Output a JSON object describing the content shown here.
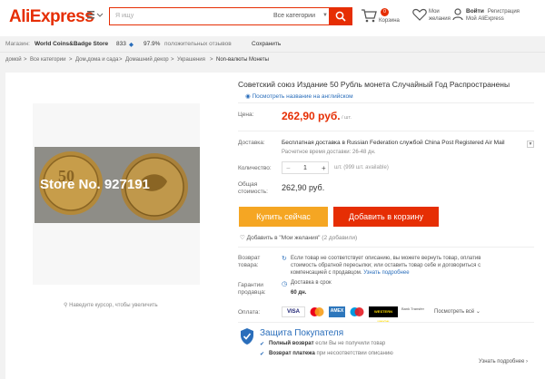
{
  "header": {
    "logo": "AliExpress",
    "search_placeholder": "Я ищу",
    "category": "Все категории",
    "cart_count": "0",
    "cart_label": "Корзина",
    "wishlist_label": "Мои желания",
    "signin": "Войти",
    "register": "Регистрация",
    "my_account": "Мой AliExpress"
  },
  "store": {
    "label": "Магазин:",
    "name": "World Coins&Badge Store",
    "score": "833",
    "positive": "97.9%",
    "positive_label": "положительных отзывов",
    "save": "Сохранить"
  },
  "breadcrumbs": [
    "домой",
    "Все категории",
    "Дом,дома и сада",
    "Домашний декор",
    "Украшения",
    "Non-валюты Монеты"
  ],
  "product": {
    "title": "Советский союз Издание 50 Рубль монета Случайный Год Распространены",
    "translate_link": "Посмотреть название на английском",
    "image_watermark": "Store No. 927191",
    "hint": "Наведите курсор, чтобы увеличить",
    "price_label": "Цена:",
    "price": "262,90 руб.",
    "price_unit": "/ шт.",
    "shipping_label": "Доставка:",
    "shipping_text": "Бесплатная доставка в Russian Federation службой China Post Registered Air Mail",
    "shipping_time": "Расчетное время доставки: 26-48 дн.",
    "qty_label": "Количество:",
    "qty": "1",
    "qty_minus": "−",
    "qty_plus": "+",
    "availability": "шт. (999 шт. available)",
    "total_label_1": "Общая",
    "total_label_2": "стоимость:",
    "total": "262,90 руб.",
    "buy_now": "Купить сейчас",
    "add_to_cart": "Добавить в корзину",
    "wishlist_add": "Добавить в \"Мои желания\"",
    "wishlist_count": "(2 добавили)",
    "return_label_1": "Возврат",
    "return_label_2": "товара:",
    "return_text": "Если товар не соответствует описанию, вы можете вернуть товар, оплатив стоимость обратной пересылки; или оставить товар себе и договориться с компенсацией с продавцом.",
    "return_more": "Узнать подробнее",
    "guarantee_label_1": "Гарантии",
    "guarantee_label_2": "продавца:",
    "guarantee_text": "Доставка в срок",
    "guarantee_days": "60 дн.",
    "payment_label": "Оплата:",
    "payment_methods": [
      "VISA",
      "MC",
      "AMEX",
      "Maestro",
      "WESTERN UNION",
      "Bank Transfer"
    ],
    "payment_all": "Посмотреть всё",
    "protection_title": "Защита Покупателя",
    "protection_1_bold": "Полный возврат",
    "protection_1_rest": "если Вы не получили товар",
    "protection_2_bold": "Возврат платежа",
    "protection_2_rest": "при несоответствии описанию",
    "learn_more": "Узнать подробнее"
  },
  "colors": {
    "brand": "#e62e04",
    "buy": "#f5a623",
    "link": "#2a6ebb"
  }
}
